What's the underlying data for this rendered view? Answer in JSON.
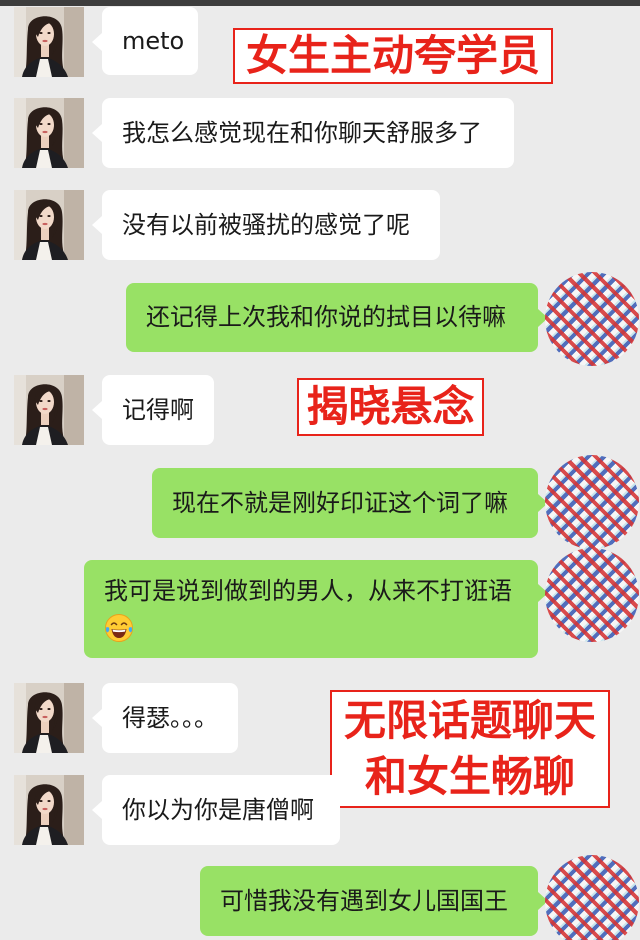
{
  "messages": [
    {
      "text": "meto"
    },
    {
      "text": "我怎么感觉现在和你聊天舒服多了"
    },
    {
      "text": "没有以前被骚扰的感觉了呢"
    },
    {
      "text": "还记得上次我和你说的拭目以待嘛"
    },
    {
      "text": "记得啊"
    },
    {
      "text": "现在不就是刚好印证这个词了嘛"
    },
    {
      "text": "我可是说到做到的男人，从来不打诳语",
      "emoji_icon": "laughing-with-tears-icon"
    },
    {
      "text": "得瑟。。。"
    },
    {
      "text": "你以为你是唐僧啊"
    },
    {
      "text": "可惜我没有遇到女儿国国王"
    }
  ],
  "annotations": [
    {
      "lines": [
        "女生主动夸学员"
      ]
    },
    {
      "lines": [
        "揭晓悬念"
      ]
    },
    {
      "lines": [
        "无限话题聊天",
        "和女生畅聊"
      ]
    }
  ],
  "icons": {
    "contact_avatar": "photo-avatar",
    "own_avatar": "plaid-pattern-avatar"
  },
  "colors": {
    "background": "#ebebeb",
    "received_bubble": "#ffffff",
    "sent_bubble": "#98e165",
    "annotation": "#e8231a"
  }
}
